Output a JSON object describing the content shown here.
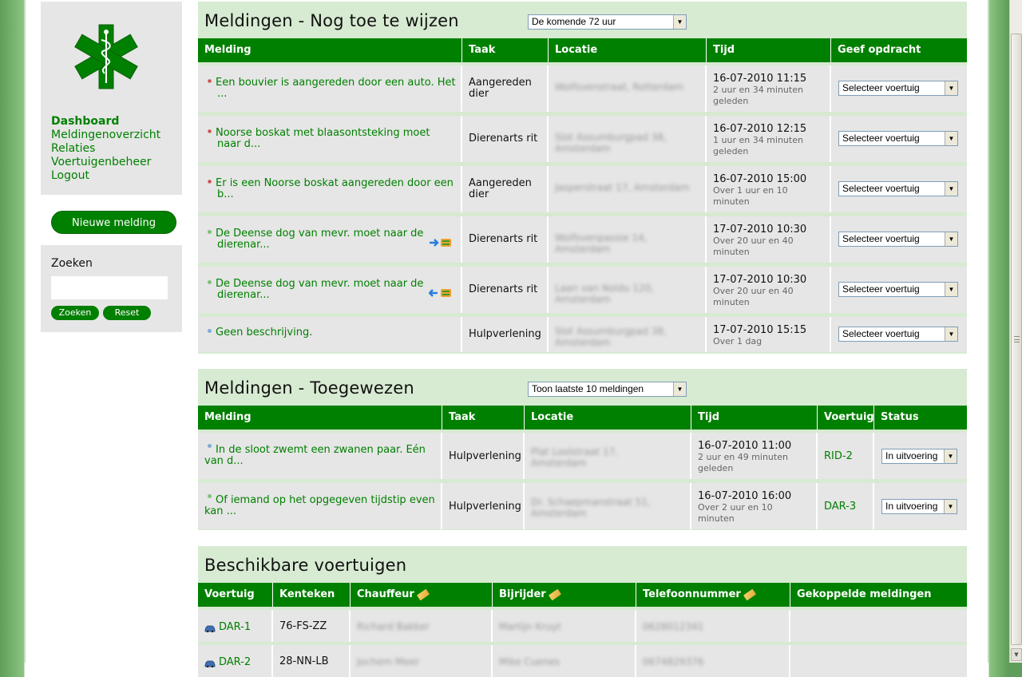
{
  "sidebar": {
    "nav": [
      "Dashboard",
      "Meldingenoverzicht",
      "Relaties",
      "Voertuigenbeheer",
      "Logout"
    ],
    "new_button": "Nieuwe melding",
    "search": {
      "title": "Zoeken",
      "value": "",
      "search_label": "Zoeken",
      "reset_label": "Reset"
    }
  },
  "open": {
    "title": "Meldingen - Nog toe te wijzen",
    "filter": "De komende 72 uur",
    "headers": [
      "Melding",
      "Taak",
      "Locatie",
      "Tijd",
      "Geef opdracht"
    ],
    "rows": [
      {
        "status": "red",
        "desc": "Een bouvier is aangereden door een auto. Het ...",
        "task": "Aangereden dier",
        "loc": "Wolfsvenstraat, Rotterdam",
        "time": "16-07-2010 11:15",
        "ago": "2 uur en 34 minuten geleden",
        "select": "Selecteer voertuig"
      },
      {
        "status": "red",
        "desc": "Noorse boskat met blaasontsteking moet naar d...",
        "task": "Dierenarts rit",
        "loc": "Slot Assumburgpad 38, Amsterdam",
        "time": "16-07-2010 12:15",
        "ago": "1 uur en 34 minuten geleden",
        "select": "Selecteer voertuig"
      },
      {
        "status": "red",
        "desc": "Er is een Noorse boskat aangereden door een b...",
        "task": "Aangereden dier",
        "loc": "Jasperstraat 17, Amsterdam",
        "time": "16-07-2010 15:00",
        "ago": "Over 1 uur en 10 minuten",
        "select": "Selecteer voertuig"
      },
      {
        "status": "green",
        "desc": "De Deense dog van mevr. moet naar de dierenar...",
        "task": "Dierenarts rit",
        "loc": "Wolfsvenpassie 14, Amsterdam",
        "time": "17-07-2010 10:30",
        "ago": "Over 20 uur en 40 minuten",
        "select": "Selecteer voertuig",
        "arrow": "right"
      },
      {
        "status": "green",
        "desc": "De Deense dog van mevr. moet naar de dierenar...",
        "task": "Dierenarts rit",
        "loc": "Laan van Noldu 120, Amsterdam",
        "time": "17-07-2010 10:30",
        "ago": "Over 20 uur en 40 minuten",
        "select": "Selecteer voertuig",
        "arrow": "left"
      },
      {
        "status": "blue",
        "desc": "Geen beschrijving.",
        "task": "Hulpverlening",
        "loc": "Slot Assumburgpad 38, Amsterdam",
        "time": "17-07-2010 15:15",
        "ago": "Over 1 dag",
        "select": "Selecteer voertuig"
      }
    ]
  },
  "assigned": {
    "title": "Meldingen - Toegewezen",
    "filter": "Toon laatste 10 meldingen",
    "headers": [
      "Melding",
      "Taak",
      "Locatie",
      "Tijd",
      "Voertuig",
      "Status"
    ],
    "rows": [
      {
        "status": "blue",
        "desc": "In de sloot zwemt een zwanen paar. Eén van d...",
        "task": "Hulpverlening",
        "loc": "Plat Loolstraat 17, Amsterdam",
        "time": "16-07-2010 11:00",
        "ago": "2 uur en 49 minuten geleden",
        "vehicle": "RID-2",
        "state": "In uitvoering"
      },
      {
        "status": "green",
        "desc": "Of iemand op het opgegeven tijdstip even kan ...",
        "task": "Hulpverlening",
        "loc": "Dr. Schaepmanstraat 51, Amsterdam",
        "time": "16-07-2010 16:00",
        "ago": "Over 2 uur en 10 minuten",
        "vehicle": "DAR-3",
        "state": "In uitvoering"
      }
    ]
  },
  "vehicles": {
    "title": "Beschikbare voertuigen",
    "headers": [
      "Voertuig",
      "Kenteken",
      "Chauffeur",
      "Bijrijder",
      "Telefoonnummer",
      "Gekoppelde meldingen"
    ],
    "rows": [
      {
        "vehicle": "DAR-1",
        "plate": "76-FS-ZZ",
        "driver": "Richard Bakker",
        "codriver": "Martijn Kruyt",
        "phone": "0628012341",
        "linked": ""
      },
      {
        "vehicle": "DAR-2",
        "plate": "28-NN-LB",
        "driver": "Jochem Meer",
        "codriver": "Mike Cuenes",
        "phone": "0674829376",
        "linked": ""
      }
    ]
  },
  "colors": {
    "green": "#008000",
    "panel": "#d7ead2",
    "cell": "#e6e6e6"
  }
}
